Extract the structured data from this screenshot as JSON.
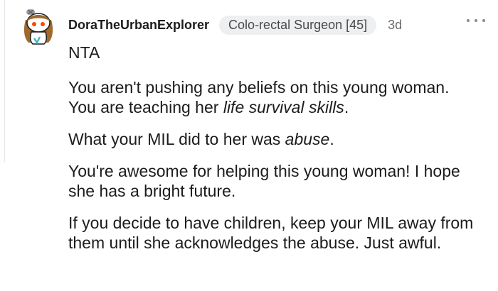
{
  "comment": {
    "username": "DoraTheUrbanExplorer",
    "flair": "Colo-rectal Surgeon [45]",
    "age": "3d",
    "verdict": "NTA",
    "paragraphs": [
      {
        "a": "You aren't pushing any beliefs on this young woman. You are teaching her ",
        "em": "life survival skills",
        "b": "."
      },
      {
        "a": "What your MIL did to her was ",
        "em": "abuse",
        "b": "."
      },
      {
        "a": "You're awesome for helping this young woman! I hope she has a bright future.",
        "em": "",
        "b": ""
      },
      {
        "a": "If you decide to have children, keep your MIL away from them until she acknowledges the abuse. Just awful.",
        "em": "",
        "b": ""
      }
    ]
  },
  "colors": {
    "flair_bg": "#edeff1",
    "text": "#1c1c1c",
    "meta": "#6b6b6b"
  },
  "icons": {
    "avatar": "snoo-avatar-icon",
    "more": "more-options-icon"
  }
}
